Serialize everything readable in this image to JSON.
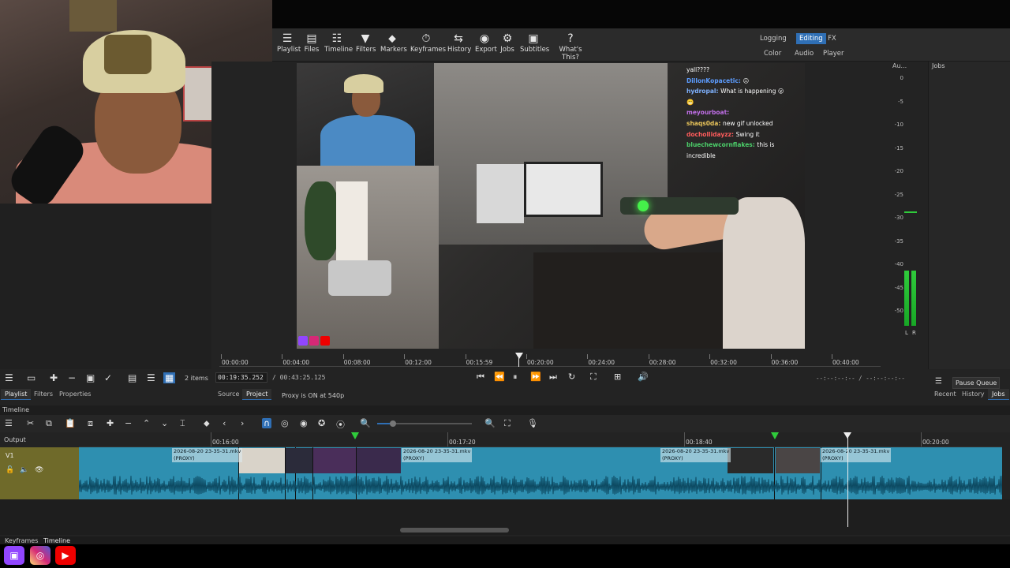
{
  "toolbar": {
    "buttons": [
      {
        "label": "Playlist",
        "icon": "list-icon"
      },
      {
        "label": "Files",
        "icon": "files-icon"
      },
      {
        "label": "Timeline",
        "icon": "timeline-icon"
      },
      {
        "label": "Filters",
        "icon": "filter-icon"
      },
      {
        "label": "Markers",
        "icon": "marker-icon"
      },
      {
        "label": "Keyframes",
        "icon": "stopwatch-icon"
      },
      {
        "label": "History",
        "icon": "history-icon"
      },
      {
        "label": "Export",
        "icon": "export-icon"
      },
      {
        "label": "Jobs",
        "icon": "gear-icon"
      },
      {
        "label": "Subtitles",
        "icon": "subtitles-icon"
      },
      {
        "label": "What's This?",
        "icon": "question-icon"
      }
    ],
    "layouts_row1": [
      "Logging",
      "Editing",
      "FX"
    ],
    "layouts_row2": [
      "Color",
      "Audio",
      "Player"
    ],
    "active_layout": "Editing"
  },
  "chat": [
    {
      "user": "",
      "msg": "yall????",
      "color": "#ffffff"
    },
    {
      "user": "DillonKopacetic:",
      "msg": "😐",
      "color": "#5c9cff"
    },
    {
      "user": "hydropal:",
      "msg": "What is happening 😮",
      "color": "#7fb2ff"
    },
    {
      "user": "",
      "msg": "😬",
      "color": "#b06be0"
    },
    {
      "user": "meyourboat:",
      "msg": "",
      "color": "#c16fe8"
    },
    {
      "user": "shaqs0da:",
      "msg": "new gif unlocked",
      "color": "#e8c45a"
    },
    {
      "user": "dochollidayzz:",
      "msg": "Swing it",
      "color": "#ff5c5c"
    },
    {
      "user": "bluechewcornflakes:",
      "msg": "this is",
      "color": "#4ccf6a"
    },
    {
      "user": "",
      "msg": "incredible",
      "color": "#ffffff"
    }
  ],
  "audio": {
    "title": "Au...",
    "scale": [
      "0",
      "-5",
      "-10",
      "-15",
      "-20",
      "-25",
      "-30",
      "-35",
      "-40",
      "-45",
      "-50"
    ],
    "channels": [
      "L",
      "R"
    ]
  },
  "jobs": {
    "title": "Jobs",
    "pause_label": "Pause Queue",
    "tabs": [
      "Recent",
      "History",
      "Jobs"
    ]
  },
  "player": {
    "ruler_labels": [
      "00:00:00",
      "00:04:00",
      "00:08:00",
      "00:12:00",
      "00:15:59",
      "00:20:00",
      "00:24:00",
      "00:28:00",
      "00:32:00",
      "00:36:00",
      "00:40:00"
    ],
    "timecode": "00:19:35.252",
    "duration": "/ 00:43:25.125",
    "inout": "--:--:--:-- / --:--:--:--",
    "proxy": "Proxy is ON at 540p",
    "tabs": [
      "Source",
      "Project"
    ]
  },
  "playlist": {
    "items": "2 items",
    "tabs": [
      "Playlist",
      "Filters",
      "Properties"
    ]
  },
  "timeline": {
    "title": "Timeline",
    "output": "Output",
    "track": "V1",
    "ruler_labels": [
      "00:16:00",
      "00:17:20",
      "00:18:40",
      "00:20:00"
    ],
    "clip_name": "2026-08-20 23-35-31.mkv",
    "proxy_tag": "(PROXY)"
  },
  "bottom_tabs": [
    "Keyframes",
    "Timeline"
  ],
  "socials": [
    "twitch",
    "instagram",
    "youtube"
  ]
}
